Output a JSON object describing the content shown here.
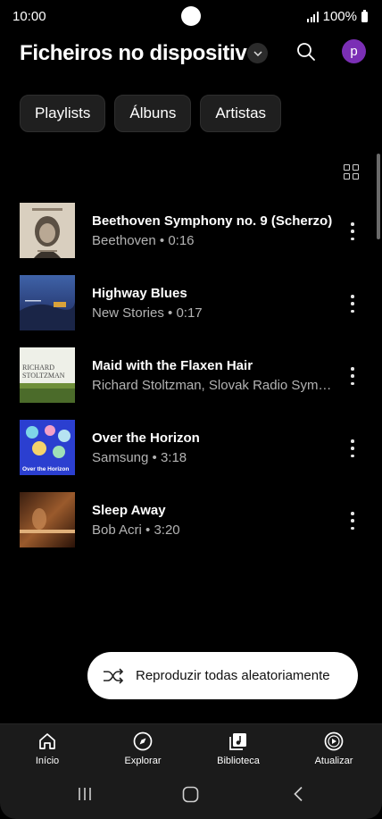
{
  "status_bar": {
    "time": "10:00",
    "battery": "100%"
  },
  "header": {
    "title": "Ficheiros no dispositivo",
    "avatar_letter": "p"
  },
  "chips": [
    "Playlists",
    "Álbuns",
    "Artistas"
  ],
  "songs": [
    {
      "title": "Beethoven Symphony no. 9 (Scherzo)",
      "subtitle": "Beethoven • 0:16",
      "art_icon": "beethoven-portrait-cover"
    },
    {
      "title": "Highway Blues",
      "subtitle": "New Stories • 0:17",
      "art_icon": "blue-night-cover"
    },
    {
      "title": "Maid with the Flaxen Hair",
      "subtitle": "Richard Stoltzman, Slovak Radio Sym…",
      "art_icon": "stoltzman-cover",
      "art_text": [
        "RICHARD",
        "STOLTZMAN"
      ]
    },
    {
      "title": "Over the Horizon",
      "subtitle": "Samsung • 3:18",
      "art_icon": "over-the-horizon-cover",
      "art_text": [
        "Over the Horizon"
      ]
    },
    {
      "title": "Sleep Away",
      "subtitle": "Bob Acri • 3:20",
      "art_icon": "piano-player-cover"
    }
  ],
  "shuffle": {
    "label": "Reproduzir todas aleatoriamente"
  },
  "bottom_nav": [
    {
      "label": "Início",
      "icon": "home-icon"
    },
    {
      "label": "Explorar",
      "icon": "compass-icon"
    },
    {
      "label": "Biblioteca",
      "icon": "library-icon",
      "active": true
    },
    {
      "label": "Atualizar",
      "icon": "upgrade-play-icon"
    }
  ],
  "colors": {
    "background": "#000000",
    "avatar": "#7b2fb5",
    "chip": "#1f1f1f",
    "nav": "#1b1b1b",
    "subtitle": "#b3b3b3"
  }
}
